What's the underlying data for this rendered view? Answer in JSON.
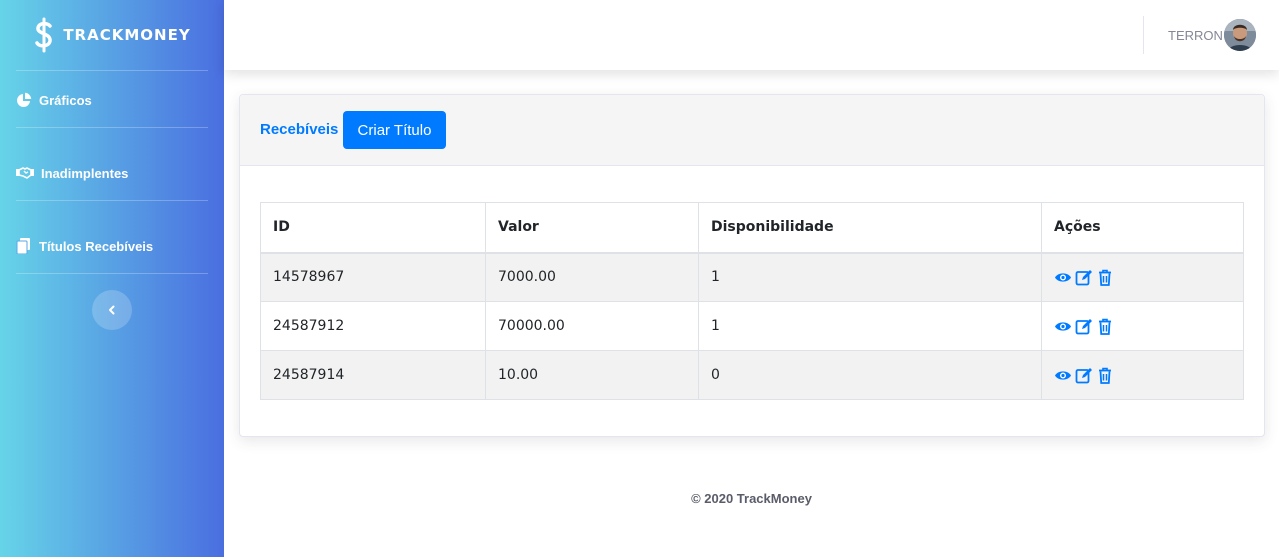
{
  "brand": {
    "name": "TRACKMONEY"
  },
  "sidebar": {
    "items": [
      {
        "label": "Gráficos",
        "icon": "chart-pie-icon"
      },
      {
        "label": "Inadimplentes",
        "icon": "handshake-icon"
      },
      {
        "label": "Títulos Recebíveis",
        "icon": "copy-icon"
      }
    ],
    "toggle_icon": "chevron-left-icon"
  },
  "topbar": {
    "username": "TERRON"
  },
  "card": {
    "title": "Recebíveis",
    "create_button": "Criar Título"
  },
  "table": {
    "columns": [
      "ID",
      "Valor",
      "Disponibilidade",
      "Ações"
    ],
    "rows": [
      {
        "id": "14578967",
        "valor": "7000.00",
        "disponibilidade": "1"
      },
      {
        "id": "24587912",
        "valor": "70000.00",
        "disponibilidade": "1"
      },
      {
        "id": "24587914",
        "valor": "10.00",
        "disponibilidade": "0"
      }
    ],
    "row_action_icons": [
      "eye-icon",
      "edit-icon",
      "trash-icon"
    ]
  },
  "footer": {
    "text": "© 2020 TrackMoney"
  },
  "colors": {
    "primary": "#007bff",
    "sidebar_gradient_start": "#66d4e8",
    "sidebar_gradient_end": "#4a6ee0"
  }
}
